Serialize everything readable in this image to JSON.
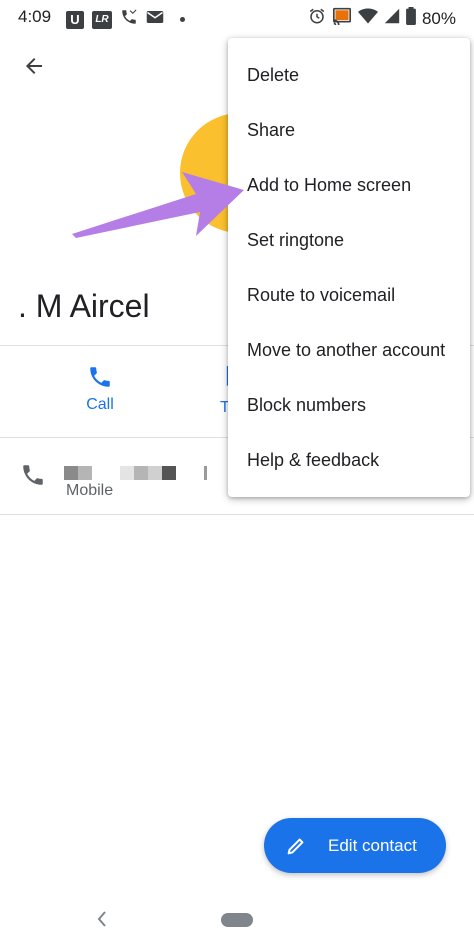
{
  "status_bar": {
    "time": "4:09",
    "left_icons": [
      "u-app-icon",
      "lr-app-icon",
      "missed-call-icon",
      "email-icon",
      "notification-dot-icon"
    ],
    "u_label": "U",
    "lr_label": "LR",
    "right_icons": [
      "alarm-icon",
      "cast-icon",
      "wifi-icon",
      "signal-icon",
      "battery-icon"
    ],
    "battery": "80%"
  },
  "header": {
    "back_icon": "arrow-back-icon"
  },
  "contact": {
    "name": ". M Aircel",
    "avatar_color": "#fbc02d"
  },
  "actions": {
    "call_label": "Call",
    "text_label_partial": "T"
  },
  "phone_entry": {
    "type": "Mobile"
  },
  "overflow_menu": {
    "items": [
      "Delete",
      "Share",
      "Add to Home screen",
      "Set ringtone",
      "Route to voicemail",
      "Move to another account",
      "Block numbers",
      "Help & feedback"
    ]
  },
  "fab": {
    "label": "Edit contact",
    "icon": "pencil-icon"
  },
  "colors": {
    "accent": "#1a73e8",
    "arrow": "#b57ee6",
    "avatar": "#fbc02d"
  }
}
